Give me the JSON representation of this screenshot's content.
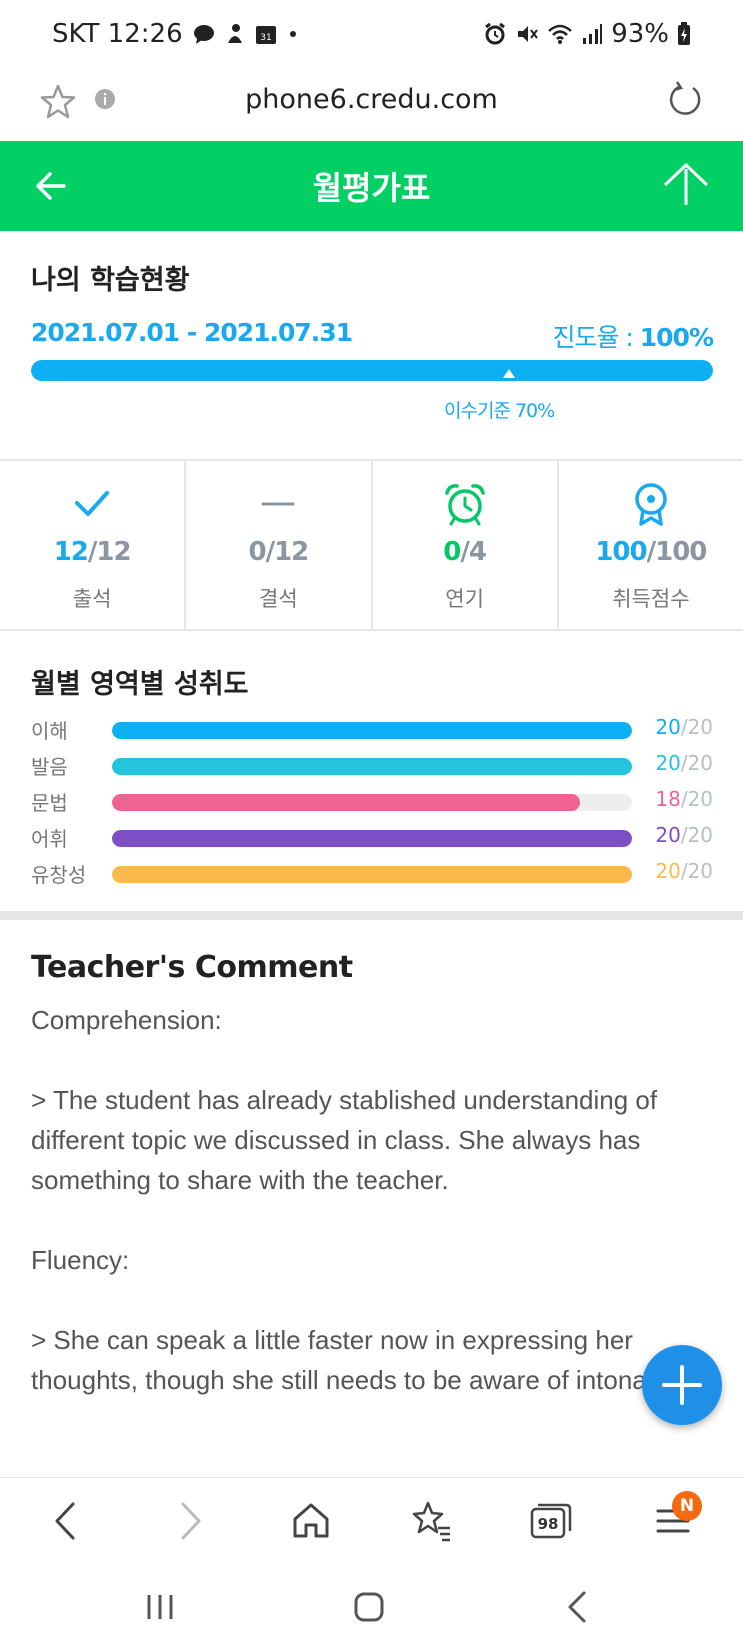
{
  "status_bar": {
    "carrier_time": "SKT 12:26",
    "battery": "93%"
  },
  "browser": {
    "url": "phone6.credu.com"
  },
  "header": {
    "title": "월평가표"
  },
  "learning": {
    "title": "나의 학습현황",
    "period": "2021.07.01 - 2021.07.31",
    "progress_label": "진도율 : ",
    "progress_value": "100%",
    "progress_fraction": 1.0,
    "criterion_label": "이수기준 70%"
  },
  "stats": [
    {
      "icon": "check-icon",
      "value": "12",
      "total": "/12",
      "label": "출석",
      "color": "#1aa8ee"
    },
    {
      "icon": "dash-icon",
      "value": "0",
      "total": "/12",
      "label": "결석",
      "color": "#8a97a3"
    },
    {
      "icon": "alarm-clock-icon",
      "value": "0",
      "total": "/4",
      "label": "연기",
      "color": "#00c864"
    },
    {
      "icon": "award-icon",
      "value": "100",
      "total": "/100",
      "label": "취득점수",
      "color": "#1aa8ee"
    }
  ],
  "achievement": {
    "title": "월별 영역별 성취도",
    "rows": [
      {
        "label": "이해",
        "score": "20",
        "max": "/20",
        "fraction": 1.0,
        "color": "#0cb0f2"
      },
      {
        "label": "발음",
        "score": "20",
        "max": "/20",
        "fraction": 1.0,
        "color": "#23c4dc"
      },
      {
        "label": "문법",
        "score": "18",
        "max": "/20",
        "fraction": 0.9,
        "color": "#ef6393"
      },
      {
        "label": "어휘",
        "score": "20",
        "max": "/20",
        "fraction": 1.0,
        "color": "#7e4fc4"
      },
      {
        "label": "유창성",
        "score": "20",
        "max": "/20",
        "fraction": 1.0,
        "color": "#fbb84d"
      }
    ]
  },
  "comment": {
    "title": "Teacher's Comment",
    "body": "Comprehension:\n\n> The student has already stablished understanding of different topic we discussed in class. She always has something to share with the teacher.\n\nFluency:\n\n> She can speak a little faster now in expressing her thoughts, though she still needs to be aware of intonations."
  },
  "toolbar": {
    "tab_count": "98",
    "menu_badge": "N"
  }
}
